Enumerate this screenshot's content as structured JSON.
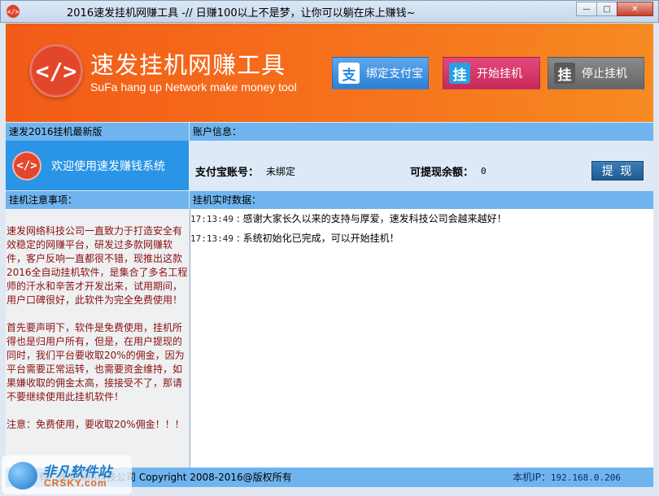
{
  "window": {
    "title": "2016速发挂机网赚工具 -// 日赚100以上不是梦，让你可以躺在床上赚钱~",
    "minimize": "—",
    "maximize": "□",
    "close": "✕"
  },
  "header": {
    "logo_glyph": "</>",
    "title": "速发挂机网赚工具",
    "subtitle": "SuFa hang up Network make money tool",
    "buttons": [
      {
        "icon": "支",
        "label": "绑定支付宝"
      },
      {
        "icon": "挂",
        "label": "开始挂机"
      },
      {
        "icon": "挂",
        "label": "停止挂机"
      }
    ]
  },
  "left": {
    "version_header": "速发2016挂机最新版",
    "welcome_glyph": "</>",
    "welcome_text": "欢迎使用速发赚钱系统",
    "notes_header": "挂机注意事项：",
    "notes": [
      "  速发网络科技公司一直致力于打造安全有效稳定的网赚平台，研发过多款网赚软件，客户反响一直都很不错，现推出这款2016全自动挂机软件，是集合了多名工程师的汗水和辛苦才开发出来，试用期间，用户口碑很好，此软件为完全免费使用！",
      "  首先要声明下，软件是免费使用，挂机所得也是归用户所有，但是，在用户提现的同时，我们平台要收取20%的佣金，因为平台需要正常运转，也需要资金维持，如果嫌收取的佣金太高，接接受不了，那请不要继续使用此挂机软件！",
      "  注意：免费使用，要收取20%佣金！！！"
    ]
  },
  "account": {
    "header": "账户信息：",
    "alipay_label": "支付宝账号：",
    "alipay_value": "未绑定",
    "balance_label": "可提现余额：",
    "balance_value": "0",
    "withdraw_button": "提 现"
  },
  "log": {
    "header": "挂机实时数据：",
    "entries": [
      {
        "time": "17:13:49",
        "text": " : 感谢大家长久以来的支持与厚爱，速发科技公司会越来越好！"
      },
      {
        "time": "17:13:49",
        "text": " : 系统初始化已完成，可以开始挂机！"
      }
    ]
  },
  "footer": {
    "copyright": "版权所有：速发网络科技公司 Copyright 2008-2016@版权所有",
    "ip_label": "本机IP：",
    "ip_value": "192.168.0.206"
  },
  "watermark": {
    "line1": "非凡软件站",
    "line2": "CRSKY.com"
  }
}
